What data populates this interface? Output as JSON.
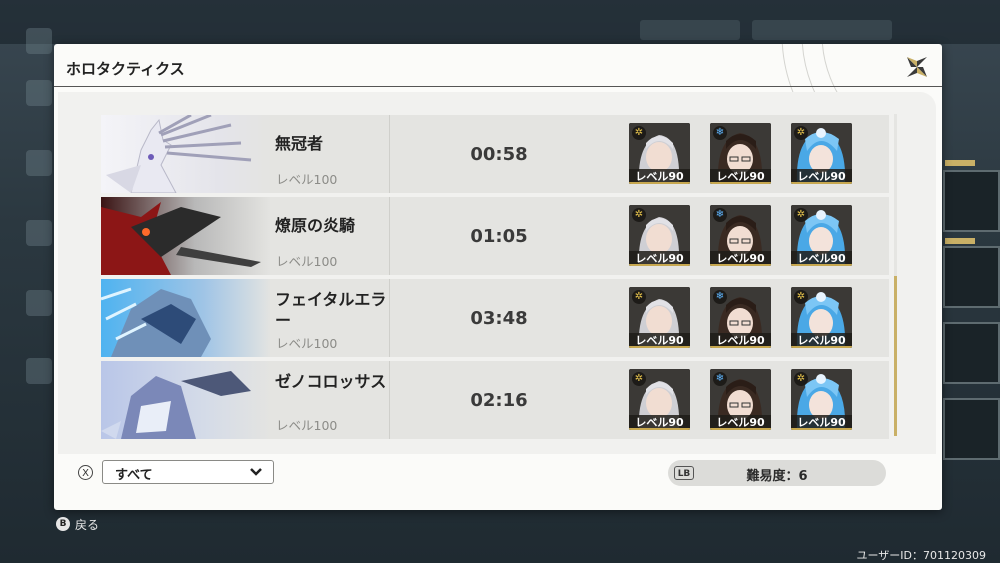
{
  "panel": {
    "title": "ホロタクティクス"
  },
  "records": [
    {
      "boss": "無冠者",
      "level": "レベル100",
      "time": "00:58"
    },
    {
      "boss": "燎原の炎騎",
      "level": "レベル100",
      "time": "01:05"
    },
    {
      "boss": "フェイタルエラー",
      "level": "レベル100",
      "time": "03:48"
    },
    {
      "boss": "ゼノコロッサス",
      "level": "レベル100",
      "time": "02:16"
    }
  ],
  "team": [
    {
      "level": "レベル90",
      "element": "sun",
      "icon": "sun-element-icon"
    },
    {
      "level": "レベル90",
      "element": "ice",
      "icon": "ice-element-icon"
    },
    {
      "level": "レベル90",
      "element": "sun",
      "icon": "sun-element-icon"
    }
  ],
  "filter": {
    "key": "X",
    "value": "すべて"
  },
  "difficulty": {
    "key": "LB",
    "label": "難易度：6"
  },
  "footer": {
    "back_key": "B",
    "back_label": "戻る",
    "user_id": "ユーザーID：701120309"
  },
  "colors": {
    "accent_gold": "#c9b066",
    "ice": "#5fb6ff",
    "sun": "#e7c44c"
  }
}
